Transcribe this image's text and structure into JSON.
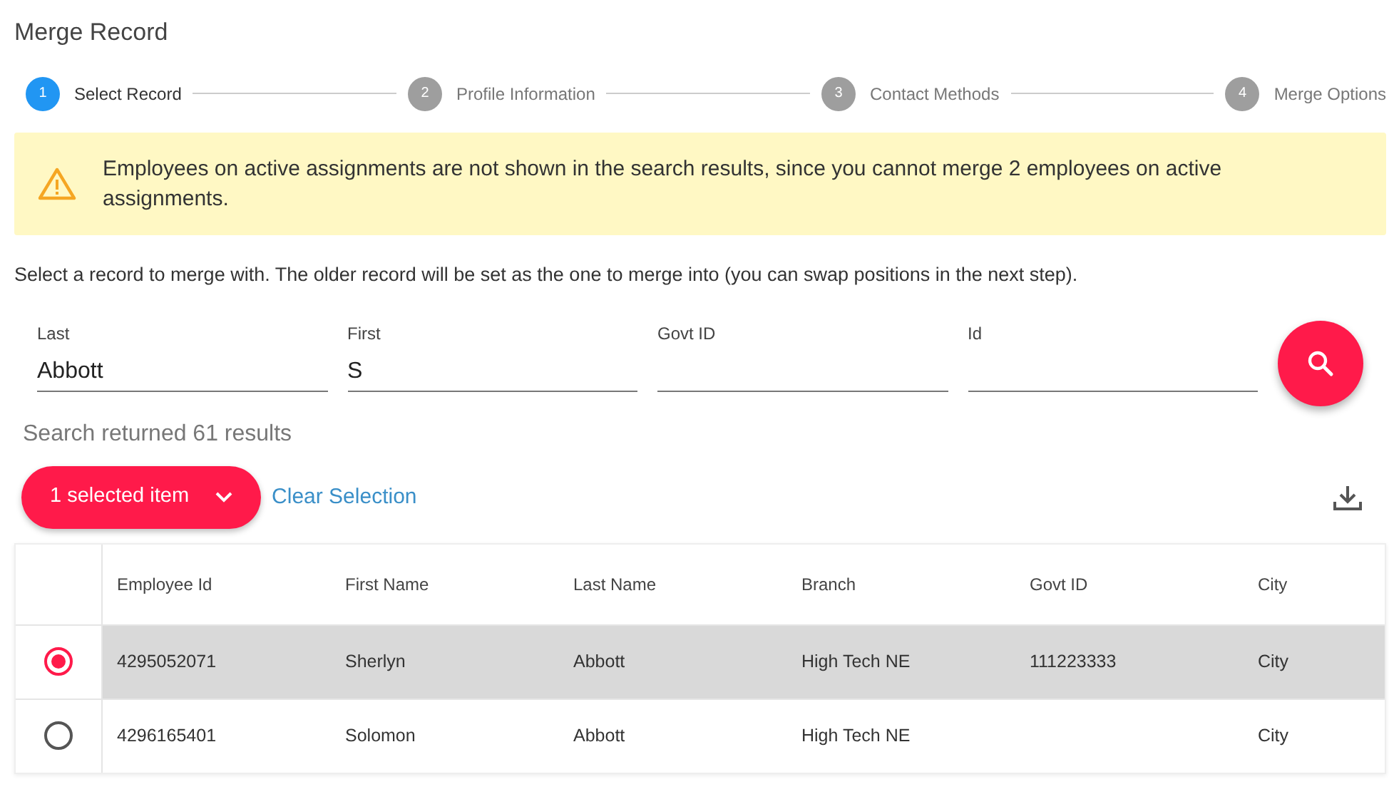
{
  "title": "Merge Record",
  "steps": [
    {
      "number": "1",
      "label": "Select Record",
      "selected": true
    },
    {
      "number": "2",
      "label": "Profile Information",
      "selected": false
    },
    {
      "number": "3",
      "label": "Contact Methods",
      "selected": false
    },
    {
      "number": "4",
      "label": "Merge Options",
      "selected": false
    }
  ],
  "alert": {
    "text": "Employees on active assignments are not shown in the search results, since you cannot merge 2 employees on active assignments."
  },
  "instructions": "Select a record to merge with. The older record will be set as the one to merge into (you can swap positions in the next step).",
  "fields": [
    {
      "label": "Last",
      "value": "Abbott"
    },
    {
      "label": "First",
      "value": "S"
    },
    {
      "label": "Govt ID"
    },
    {
      "label": "Id"
    }
  ],
  "results_text": "Search returned 61 results",
  "selection_button": "1 selected item",
  "clear_selection": "Clear Selection",
  "table": {
    "columns": [
      "Employee Id",
      "First Name",
      "Last Name",
      "Branch",
      "Govt ID",
      "City"
    ],
    "rows": [
      {
        "selected": true,
        "cells": [
          "4295052071",
          "Sherlyn",
          "Abbott",
          "High Tech NE",
          "111223333",
          "City"
        ]
      },
      {
        "selected": false,
        "cells": [
          "4296165401",
          "Solomon",
          "Abbott",
          "High Tech NE",
          "",
          "City"
        ]
      }
    ]
  }
}
